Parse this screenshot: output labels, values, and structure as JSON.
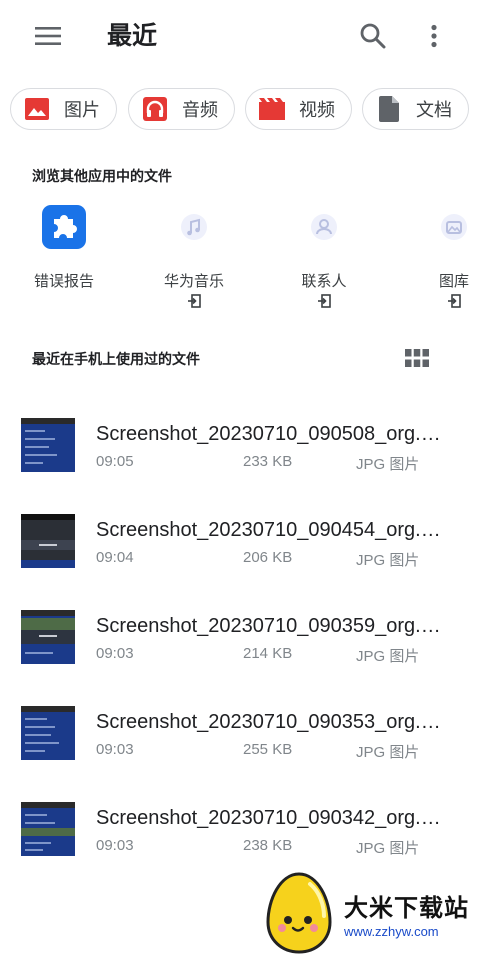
{
  "header": {
    "title": "最近",
    "menu_icon": "menu-icon",
    "search_icon": "search-icon",
    "more_icon": "more-vert-icon"
  },
  "chips": [
    {
      "label": "图片",
      "icon": "image-icon",
      "color": "#e53935"
    },
    {
      "label": "音频",
      "icon": "headphones-icon",
      "color": "#e53935"
    },
    {
      "label": "视频",
      "icon": "movie-icon",
      "color": "#e53935"
    },
    {
      "label": "文档",
      "icon": "document-icon",
      "color": "#5f6368"
    }
  ],
  "other_apps": {
    "heading": "浏览其他应用中的文件",
    "items": [
      {
        "label": "错误报告",
        "icon": "puzzle-icon",
        "color": "#1a73e8"
      },
      {
        "label": "华为音乐",
        "icon": "music-app-icon"
      },
      {
        "label": "联系人",
        "icon": "contacts-app-icon"
      },
      {
        "label": "图库",
        "icon": "gallery-app-icon"
      }
    ]
  },
  "recent": {
    "heading": "最近在手机上使用过的文件",
    "files": [
      {
        "name": "Screenshot_20230710_090508_org.…",
        "time": "09:05",
        "size": "233 KB",
        "type": "JPG 图片"
      },
      {
        "name": "Screenshot_20230710_090454_org.…",
        "time": "09:04",
        "size": "206 KB",
        "type": "JPG 图片"
      },
      {
        "name": "Screenshot_20230710_090359_org.…",
        "time": "09:03",
        "size": "214 KB",
        "type": "JPG 图片"
      },
      {
        "name": "Screenshot_20230710_090353_org.…",
        "time": "09:03",
        "size": "255 KB",
        "type": "JPG 图片"
      },
      {
        "name": "Screenshot_20230710_090342_org.…",
        "time": "09:03",
        "size": "238 KB",
        "type": "JPG 图片"
      }
    ]
  },
  "watermark": {
    "title": "大米下载站",
    "url": "www.zzhyw.com"
  }
}
